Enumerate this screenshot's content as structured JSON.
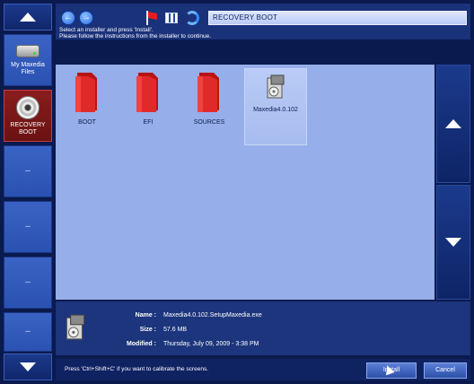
{
  "window": {
    "path": "RECOVERY BOOT"
  },
  "instructions": {
    "line1": "Select an installer and press 'Install'.",
    "line2": "Please follow the instructions from the installer to continue."
  },
  "sidebar": {
    "items": [
      {
        "label": "My Maxedia Files",
        "icon": "drive-icon"
      },
      {
        "label": "RECOVERY BOOT",
        "icon": "disc-icon",
        "active": true
      },
      {
        "label": "–"
      },
      {
        "label": "–"
      },
      {
        "label": "–"
      },
      {
        "label": "–"
      }
    ]
  },
  "files": [
    {
      "label": "BOOT",
      "icon": "folder-icon"
    },
    {
      "label": "EFI",
      "icon": "folder-icon"
    },
    {
      "label": "SOURCES",
      "icon": "folder-icon"
    },
    {
      "label": "Maxedia4.0.102",
      "icon": "installer-icon",
      "selected": true
    }
  ],
  "details": {
    "name_label": "Name :",
    "name_value": "Maxedia4.0.102.SetupMaxedia.exe",
    "size_label": "Size :",
    "size_value": "57.6 MB",
    "modified_label": "Modified :",
    "modified_value": "Thursday, July 09, 2009  -  3:38 PM"
  },
  "status": {
    "text": "Press 'Ctrl+Shift+C' if you want to calibrate the screens."
  },
  "buttons": {
    "install": "Install",
    "cancel": "Cancel"
  },
  "colors": {
    "accent": "#1a327a",
    "file_area": "#96aee9",
    "folder": "#d61f1f",
    "active_item": "#8a1d1d"
  }
}
